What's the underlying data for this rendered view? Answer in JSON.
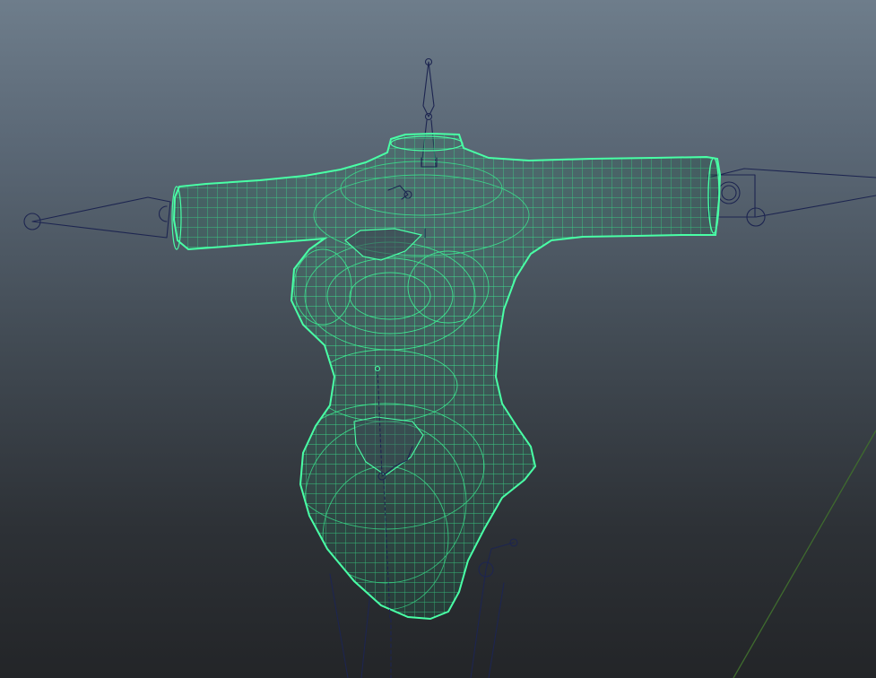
{
  "viewport": {
    "background_top": "#6e7d8b",
    "background_bottom": "#232528",
    "grid_axis_color": "#3f6b2e"
  },
  "mesh": {
    "name": "torso-bodysuit-mesh",
    "state": "selected",
    "wire_color": "#3dff9a",
    "fill_color": "#3fc98c"
  },
  "rig": {
    "joint_color": "#1d2550",
    "joints": [
      "head-joint",
      "neck-joint",
      "shoulder-l-joint",
      "shoulder-r-joint",
      "wrist-l-joint",
      "wrist-r-joint",
      "spine-joint",
      "hip-joint",
      "leg-l-joint",
      "leg-r-joint"
    ]
  }
}
